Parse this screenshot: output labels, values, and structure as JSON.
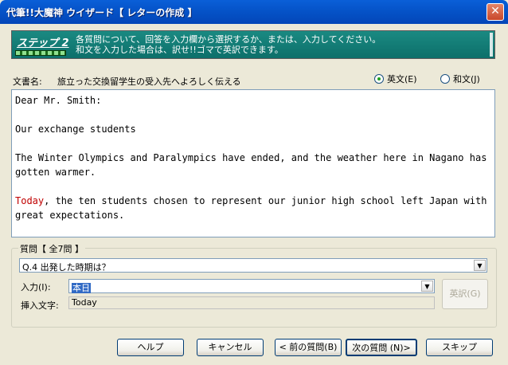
{
  "window": {
    "title": "代筆!!大魔神 ウイザード【 レターの作成 】"
  },
  "banner": {
    "step": "ステップ 2",
    "line1": "各質問について、回答を入力欄から選択するか、または、入力してください。",
    "line2": "和文を入力した場合は、訳せ!!ゴマで英訳できます。"
  },
  "document": {
    "label": "文書名:",
    "name": "旅立った交換留学生の受入先へよろしく伝える",
    "lang_english": "英文(E)",
    "lang_japanese": "和文(J)",
    "selected_lang": "english"
  },
  "letter": {
    "greeting": "Dear Mr. Smith:",
    "subject": "Our exchange students",
    "para1": "The Winter Olympics and Paralympics have ended, and the weather here in Nagano has",
    "para1b": "gotten warmer.",
    "para2_highlight": "Today",
    "para2_rest": ", the ten students chosen to represent our junior high school left Japan with",
    "para2b": "great expectations."
  },
  "question_group": {
    "title": "質問【 全7問 】",
    "question": "Q.4 出発した時期は？",
    "input_label": "入力(I):",
    "input_value": "本日",
    "insert_label": "挿入文字:",
    "insert_value": "Today",
    "translate_button": "英訳(G)"
  },
  "buttons": {
    "help": "ヘルプ",
    "cancel": "キャンセル",
    "prev": "< 前の質問(B)",
    "next": "次の質問 (N)>",
    "skip": "スキップ"
  },
  "colors": {
    "banner": "#0d6f6a",
    "highlight_word": "#c00000",
    "titlebar": "#0553c8"
  }
}
